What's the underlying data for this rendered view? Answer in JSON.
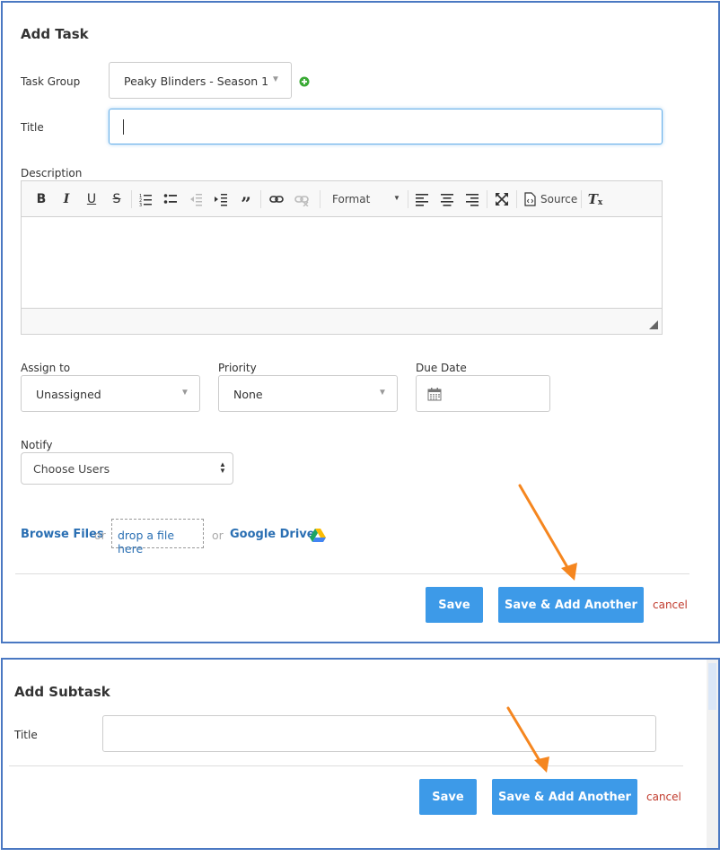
{
  "task": {
    "title": "Add Task",
    "task_group_label": "Task Group",
    "task_group_value": "Peaky Blinders - Season 1",
    "title_label": "Title",
    "title_value": "",
    "description_label": "Description",
    "editor": {
      "format_label": "Format",
      "source_label": "Source"
    },
    "assign_label": "Assign to",
    "assign_value": "Unassigned",
    "priority_label": "Priority",
    "priority_value": "None",
    "due_label": "Due Date",
    "due_value": "",
    "notify_label": "Notify",
    "notify_value": "Choose Users",
    "upload": {
      "browse": "Browse Files",
      "or1": "or",
      "drop": "drop a file here",
      "or2": "or",
      "gdrive": "Google Drive"
    },
    "save_label": "Save",
    "save_add_label": "Save & Add Another",
    "cancel_label": "cancel"
  },
  "subtask": {
    "title": "Add Subtask",
    "title_label": "Title",
    "title_value": "",
    "save_label": "Save",
    "save_add_label": "Save & Add Another",
    "cancel_label": "cancel"
  },
  "colors": {
    "panel_border": "#4a78c2",
    "button": "#3d9ae8",
    "cancel": "#c0392b",
    "link": "#2a6fb3",
    "arrow": "#f5861f",
    "add_icon": "#3aaa35"
  },
  "icons": [
    "bold-icon",
    "italic-icon",
    "underline-icon",
    "strikethrough-icon",
    "numbered-list-icon",
    "bullet-list-icon",
    "outdent-icon",
    "indent-icon",
    "blockquote-icon",
    "link-icon",
    "unlink-icon",
    "maximize-icon",
    "source-icon",
    "remove-format-icon",
    "calendar-icon",
    "google-drive-icon",
    "plus-circle-icon",
    "resize-handle-icon"
  ]
}
